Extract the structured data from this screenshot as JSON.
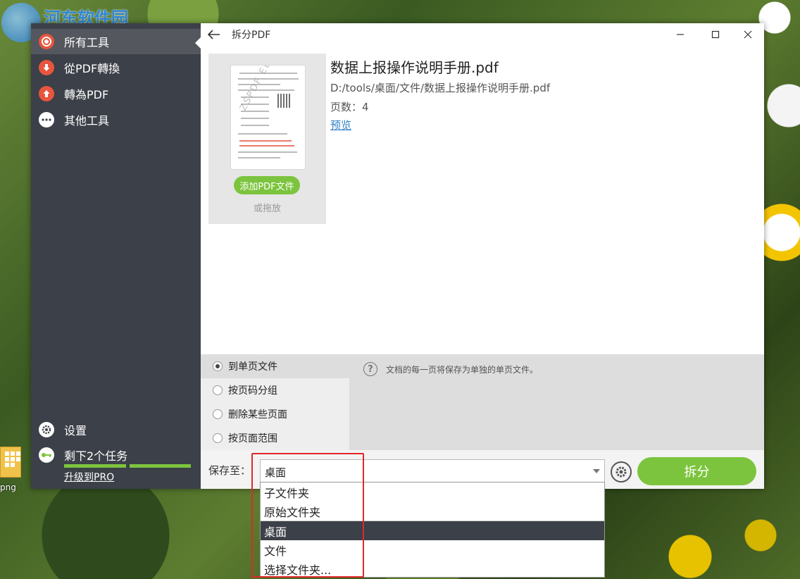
{
  "watermark": {
    "site_name": "河东软件园"
  },
  "desktop": {
    "icon_label": "png"
  },
  "window": {
    "title": "拆分PDF"
  },
  "sidebar": {
    "items": [
      {
        "label": "所有工具",
        "icon": "target-icon"
      },
      {
        "label": "從PDF轉換",
        "icon": "arrow-down-icon"
      },
      {
        "label": "轉為PDF",
        "icon": "arrow-up-icon"
      },
      {
        "label": "其他工具",
        "icon": "more-icon"
      }
    ],
    "settings_label": "设置",
    "tasks_label": "剩下2个任务",
    "upgrade_label": "升级到PRO",
    "tasks_progress": 1.0
  },
  "file": {
    "name": "数据上报操作说明手册.pdf",
    "path": "D:/tools/桌面/文件/数据上报操作说明手册.pdf",
    "pages_label": "页数：",
    "pages_value": "4",
    "preview_label": "预览",
    "add_button": "添加PDF文件",
    "drop_hint": "或拖放",
    "thumb_watermark": "ZSPDF EDITOR"
  },
  "options": {
    "items": [
      {
        "label": "到单页文件",
        "selected": true
      },
      {
        "label": "按页码分组",
        "selected": false
      },
      {
        "label": "删除某些页面",
        "selected": false
      },
      {
        "label": "按页面范围",
        "selected": false
      }
    ],
    "help_text": "文档的每一页将保存为单独的单页文件。"
  },
  "save": {
    "label": "保存至：",
    "selected": "桌面",
    "split_button": "拆分"
  },
  "dropdown": {
    "items": [
      "子文件夹",
      "原始文件夹",
      "桌面",
      "文件",
      "选择文件夹..."
    ],
    "highlighted_index": 2
  },
  "colors": {
    "accent_green": "#7cc43e",
    "sidebar_bg": "#3c4048",
    "link_blue": "#2e7fc6",
    "annotation_red": "#e0282a"
  }
}
